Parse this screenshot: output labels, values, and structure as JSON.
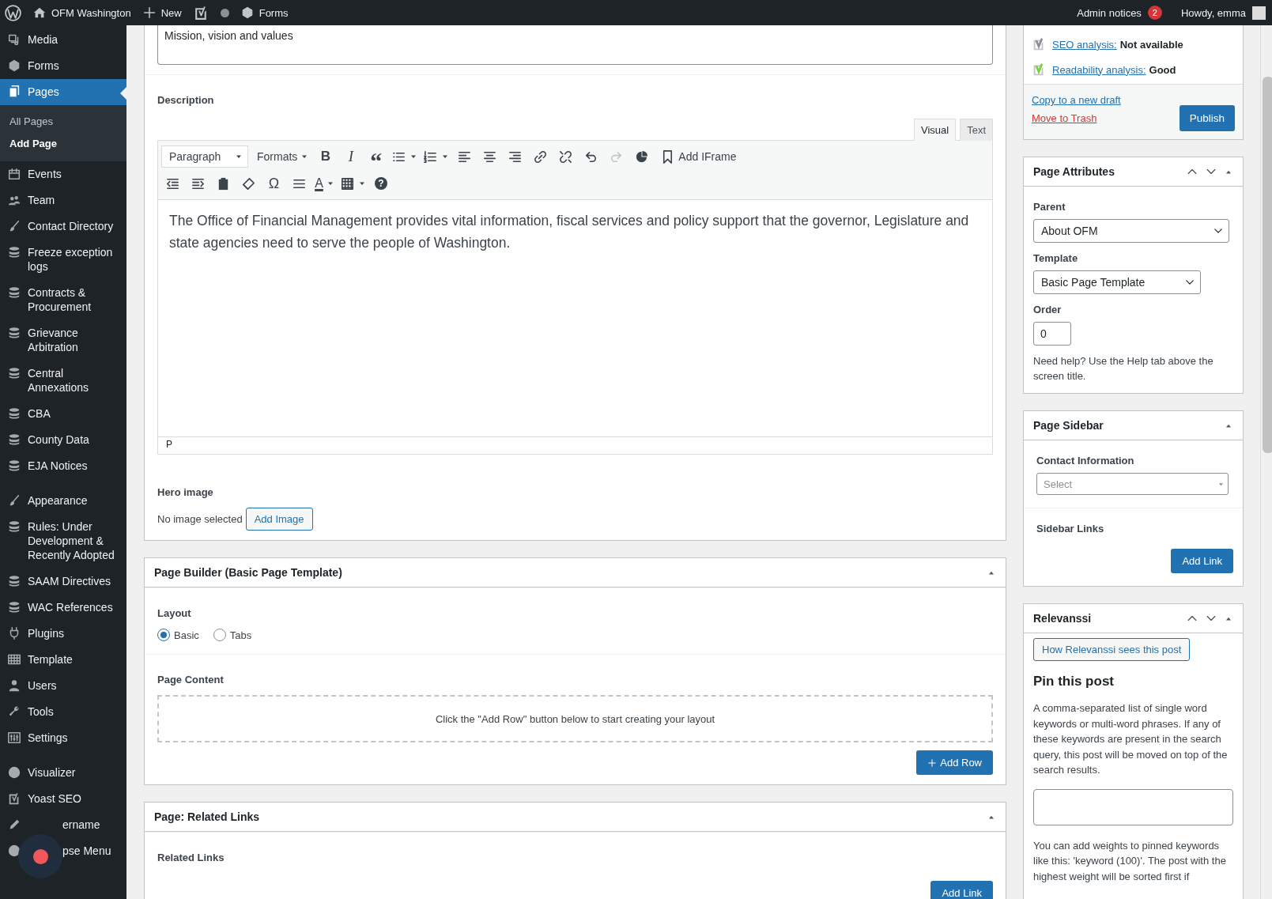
{
  "admin_bar": {
    "site": "OFM Washington",
    "new": "New",
    "forms": "Forms",
    "notices": "Admin notices",
    "notice_count": "2",
    "greeting": "Howdy, emma"
  },
  "sidebar": {
    "groups": [
      [
        {
          "label": "Media",
          "selected": false
        },
        {
          "label": "Forms",
          "selected": false
        },
        {
          "label": "Pages",
          "selected": true,
          "children": [
            {
              "label": "All Pages",
              "selected": false
            },
            {
              "label": "Add Page",
              "selected": true
            }
          ]
        },
        {
          "label": "Events",
          "selected": false
        },
        {
          "label": "Team",
          "selected": false
        },
        {
          "label": "Contact Directory",
          "selected": false
        },
        {
          "label": "Freeze exception logs",
          "selected": false
        },
        {
          "label": "Contracts & Procurement",
          "selected": false
        },
        {
          "label": "Grievance Arbitration",
          "selected": false
        },
        {
          "label": "Central Annexations",
          "selected": false
        },
        {
          "label": "CBA",
          "selected": false
        },
        {
          "label": "County Data",
          "selected": false
        },
        {
          "label": "EJA Notices",
          "selected": false
        }
      ],
      [
        {
          "label": "Appearance",
          "selected": false
        },
        {
          "label": "Rules: Under Development & Recently Adopted",
          "selected": false
        },
        {
          "label": "SAAM Directives",
          "selected": false
        },
        {
          "label": "WAC References",
          "selected": false
        },
        {
          "label": "Plugins",
          "selected": false
        },
        {
          "label": "Template",
          "selected": false
        },
        {
          "label": "Users",
          "selected": false
        },
        {
          "label": "Tools",
          "selected": false
        },
        {
          "label": "Settings",
          "selected": false
        }
      ],
      [
        {
          "label": "Visualizer",
          "selected": false
        },
        {
          "label": "Yoast SEO",
          "selected": false
        },
        {
          "label": "ername",
          "selected": false
        },
        {
          "label": "pse Menu",
          "selected": false
        }
      ]
    ]
  },
  "title_field": {
    "value": "Mission, vision and values"
  },
  "description": {
    "label": "Description",
    "tabs": [
      {
        "label": "Visual",
        "selected": true
      },
      {
        "label": "Text",
        "selected": false
      }
    ],
    "toolbar": [
      [
        {
          "kind": "select",
          "text": "Paragraph"
        },
        {
          "kind": "menu",
          "text": "Formats"
        },
        {
          "kind": "glyph",
          "text": "B"
        },
        {
          "kind": "glyph",
          "text": "I"
        },
        {
          "kind": "glyph",
          "text": "“"
        },
        {
          "kind": "icon",
          "disabled": false
        },
        {
          "kind": "icon",
          "disabled": false
        },
        {
          "kind": "icon",
          "disabled": false
        },
        {
          "kind": "icon",
          "disabled": false
        },
        {
          "kind": "icon",
          "disabled": false
        },
        {
          "kind": "icon",
          "disabled": false
        },
        {
          "kind": "icon",
          "disabled": false
        },
        {
          "kind": "icon",
          "disabled": false
        },
        {
          "kind": "icon",
          "disabled": true
        },
        {
          "kind": "icon",
          "disabled": false
        },
        {
          "kind": "labeled",
          "text": "Add IFrame"
        }
      ],
      [
        {
          "kind": "icon",
          "disabled": false
        },
        {
          "kind": "icon",
          "disabled": false
        },
        {
          "kind": "icon",
          "disabled": false
        },
        {
          "kind": "icon",
          "disabled": false
        },
        {
          "kind": "glyph",
          "text": "Ω"
        },
        {
          "kind": "icon",
          "disabled": false
        },
        {
          "kind": "glyph",
          "text": "A"
        },
        {
          "kind": "icon",
          "disabled": false
        },
        {
          "kind": "glyph",
          "text": "?"
        }
      ]
    ],
    "content": "The Office of Financial Management provides vital information, fiscal services and policy support that the governor, Legislature and state agencies need to serve the people of Washington.",
    "path": "P"
  },
  "hero_image": {
    "label": "Hero image",
    "status": "No image selected",
    "button": "Add Image"
  },
  "page_builder": {
    "title": "Page Builder (Basic Page Template)",
    "layout_label": "Layout",
    "layouts": [
      {
        "label": "Basic",
        "selected": true
      },
      {
        "label": "Tabs",
        "selected": false
      }
    ],
    "content_label": "Page Content",
    "empty_text": "Click the \"Add Row\" button below to start creating your layout",
    "button": "Add Row"
  },
  "related_links": {
    "title": "Page: Related Links",
    "label": "Related Links",
    "button": "Add Link"
  },
  "publish": {
    "analyses": [
      {
        "label": "SEO analysis:",
        "value": "Not available",
        "color": "#8c8f94"
      },
      {
        "label": "Readability analysis:",
        "value": "Good",
        "color": "#7ad03a"
      }
    ],
    "copy_link": "Copy to a new draft",
    "trash_link": "Move to Trash",
    "button": "Publish"
  },
  "page_attributes": {
    "title": "Page Attributes",
    "parent_label": "Parent",
    "parent": "About OFM",
    "template_label": "Template",
    "template": "Basic Page Template",
    "order_label": "Order",
    "order": "0",
    "help": "Need help? Use the Help tab above the screen title."
  },
  "page_sidebar": {
    "title": "Page Sidebar",
    "contact_label": "Contact Information",
    "contact_placeholder": "Select",
    "links_label": "Sidebar Links",
    "button": "Add Link"
  },
  "relevanssi": {
    "title": "Relevanssi",
    "button": "How Relevanssi sees this post",
    "heading": "Pin this post",
    "intro": "A comma-separated list of single word keywords or multi-word phrases. If any of these keywords are present in the search query, this post will be moved on top of the search results.",
    "note": "You can add weights to pinned keywords like this: 'keyword (100)'. The post with the highest weight will be sorted first if"
  }
}
